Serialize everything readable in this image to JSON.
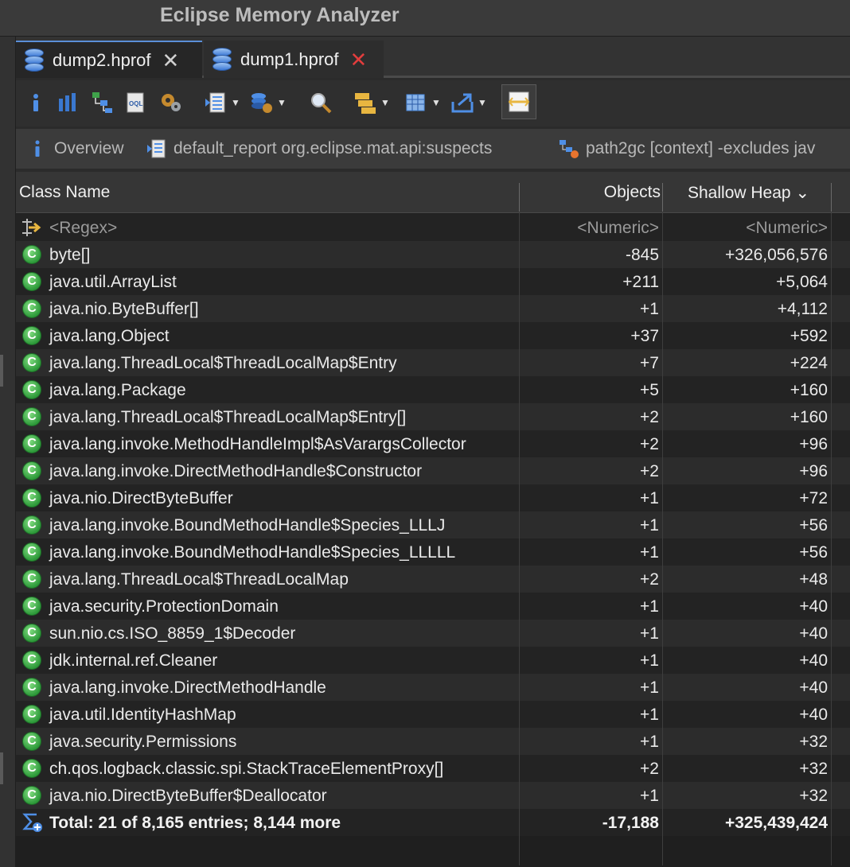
{
  "window": {
    "title": "Eclipse Memory Analyzer"
  },
  "tabs": [
    {
      "label": "dump2.hprof",
      "close": "✕"
    },
    {
      "label": "dump1.hprof",
      "close": "✕"
    }
  ],
  "toolbar": {
    "icons": [
      "info-icon",
      "histogram-icon",
      "dominator-tree-icon",
      "oql-icon",
      "heap-dump-overview-icon",
      "reports-icon",
      "query-browser-icon",
      "search-icon",
      "group-by-icon",
      "calculate-retained-icon",
      "export-icon",
      "compare-icon"
    ],
    "dropdown_glyph": "▼"
  },
  "breadcrumb": [
    {
      "label": "Overview",
      "icon": "info-icon"
    },
    {
      "label": "default_report org.eclipse.mat.api:suspects",
      "icon": "report-icon"
    },
    {
      "label": "path2gc [context] -excludes jav",
      "icon": "path-to-gc-icon"
    }
  ],
  "table": {
    "columns": [
      "Class Name",
      "Objects",
      "Shallow Heap"
    ],
    "sort_indicator": "⌄",
    "filter_row": {
      "name": "<Regex>",
      "objects": "<Numeric>",
      "heap": "<Numeric>"
    },
    "rows": [
      {
        "name": "byte[]",
        "objects": "-845",
        "heap": "+326,056,576"
      },
      {
        "name": "java.util.ArrayList",
        "objects": "+211",
        "heap": "+5,064"
      },
      {
        "name": "java.nio.ByteBuffer[]",
        "objects": "+1",
        "heap": "+4,112"
      },
      {
        "name": "java.lang.Object",
        "objects": "+37",
        "heap": "+592"
      },
      {
        "name": "java.lang.ThreadLocal$ThreadLocalMap$Entry",
        "objects": "+7",
        "heap": "+224"
      },
      {
        "name": "java.lang.Package",
        "objects": "+5",
        "heap": "+160"
      },
      {
        "name": "java.lang.ThreadLocal$ThreadLocalMap$Entry[]",
        "objects": "+2",
        "heap": "+160"
      },
      {
        "name": "java.lang.invoke.MethodHandleImpl$AsVarargsCollector",
        "objects": "+2",
        "heap": "+96"
      },
      {
        "name": "java.lang.invoke.DirectMethodHandle$Constructor",
        "objects": "+2",
        "heap": "+96"
      },
      {
        "name": "java.nio.DirectByteBuffer",
        "objects": "+1",
        "heap": "+72"
      },
      {
        "name": "java.lang.invoke.BoundMethodHandle$Species_LLLJ",
        "objects": "+1",
        "heap": "+56"
      },
      {
        "name": "java.lang.invoke.BoundMethodHandle$Species_LLLLL",
        "objects": "+1",
        "heap": "+56"
      },
      {
        "name": "java.lang.ThreadLocal$ThreadLocalMap",
        "objects": "+2",
        "heap": "+48"
      },
      {
        "name": "java.security.ProtectionDomain",
        "objects": "+1",
        "heap": "+40"
      },
      {
        "name": "sun.nio.cs.ISO_8859_1$Decoder",
        "objects": "+1",
        "heap": "+40"
      },
      {
        "name": "jdk.internal.ref.Cleaner",
        "objects": "+1",
        "heap": "+40"
      },
      {
        "name": "java.lang.invoke.DirectMethodHandle",
        "objects": "+1",
        "heap": "+40"
      },
      {
        "name": "java.util.IdentityHashMap",
        "objects": "+1",
        "heap": "+40"
      },
      {
        "name": "java.security.Permissions",
        "objects": "+1",
        "heap": "+32"
      },
      {
        "name": "ch.qos.logback.classic.spi.StackTraceElementProxy[]",
        "objects": "+2",
        "heap": "+32"
      },
      {
        "name": "java.nio.DirectByteBuffer$Deallocator",
        "objects": "+1",
        "heap": "+32"
      }
    ],
    "class_icon_letter": "C",
    "total_row": {
      "name": "Total: 21 of 8,165 entries; 8,144 more",
      "objects": "-17,188",
      "heap": "+325,439,424"
    }
  },
  "colors": {
    "accent": "#5a8fd8",
    "close_red": "#e23d3d",
    "class_icon": "#2e9a3a"
  }
}
